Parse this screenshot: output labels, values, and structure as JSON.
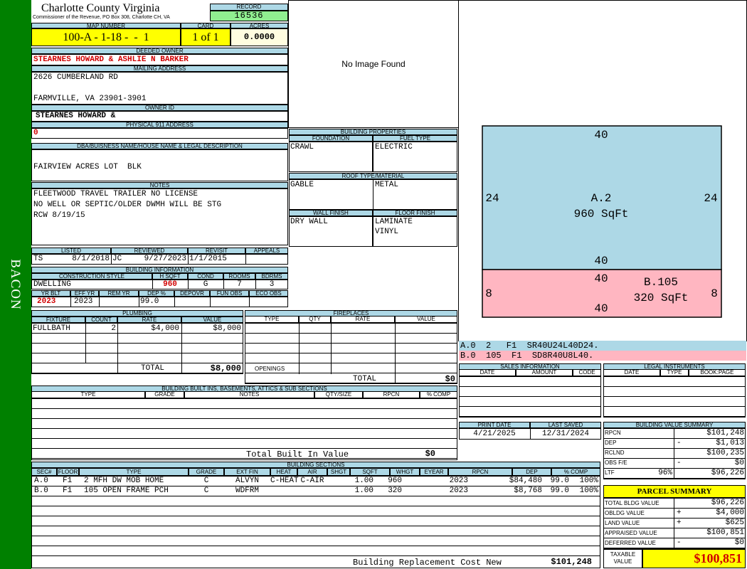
{
  "sidebar": {
    "label": "BACON"
  },
  "header": {
    "county": "Charlotte County Virginia",
    "office": "Commissioner of the Revenue, PO Box 308, Charlotte CH, VA",
    "record_label": "RECORD",
    "record": "16536"
  },
  "parcel": {
    "map_label": "MAP NUMBER",
    "map": "100-A - 1-18 -  -  1",
    "card_label": "CARD",
    "card": "1 of 1",
    "acres_label": "ACRES",
    "acres": "0.0000"
  },
  "owner": {
    "deeded_label": "DEEDED OWNER",
    "deeded": "STEARNES HOWARD & ASHLIE N BARKER",
    "mailing_label": "MAILING ADDRESS",
    "addr1": "2626 CUMBERLAND RD",
    "addr2": "FARMVILLE, VA 23901-3901",
    "owner_id_label": "OWNER ID",
    "owner_id": "STEARNES HOWARD &",
    "physical_label": "PHYSICAL 911 ADDRESS",
    "physical": "0"
  },
  "legal": {
    "label": "DBA/BUISNESS NAME/HOUSE NAME & LEGAL DESCRIPTION",
    "desc": "FAIRVIEW ACRES LOT  BLK"
  },
  "notes": {
    "label": "NOTES",
    "lines": [
      "FLEETWOOD TRAVEL TRAILER NO LICENSE",
      "NO WELL OR SEPTIC/OLDER DWMH WILL BE STG",
      "RCW 8/19/15"
    ]
  },
  "image": {
    "placeholder": "No Image Found"
  },
  "props": {
    "label": "BUILDING PROPERTIES",
    "foundation_label": "FOUNDATION",
    "foundation": "CRAWL",
    "fuel_label": "FUEL TYPE",
    "fuel": "ELECTRIC",
    "roof_label": "ROOF TYPE/MATERIAL",
    "roof_type": "GABLE",
    "roof_mat": "METAL",
    "wall_label": "WALL FINISH",
    "wall": "DRY WALL",
    "floor_label": "FLOOR FINISH",
    "floor1": "LAMINATE",
    "floor2": "VINYL"
  },
  "dates": {
    "listed_label": "LISTED",
    "listed_by": "TS",
    "listed": "8/1/2018",
    "reviewed_label": "REVIEWED",
    "reviewed_by": "JC",
    "reviewed": "9/27/2023",
    "revisit_label": "REVISIT",
    "revisit": "1/1/2015",
    "appeals_label": "APPEALS"
  },
  "building": {
    "label": "BUILDING INFORMATION",
    "style_label": "CONSTRUCTION STYLE",
    "style": "DWELLING",
    "hsqft_label": "H SQFT",
    "hsqft": "960",
    "cond_label": "COND",
    "cond": "G",
    "rooms_label": "ROOMS",
    "rooms": "7",
    "bdrms_label": "BDRMS",
    "bdrms": "3",
    "yrblt_label": "YR BLT",
    "yrblt": "2023",
    "effyr_label": "EFF YR",
    "effyr": "2023",
    "remyr_label": "REM YR",
    "dep_label": "DEP %",
    "dep": "99.0",
    "depovr_label": "DEPOVR",
    "funobs_label": "FUN OBS",
    "ecoobs_label": "ECO OBS"
  },
  "plumbing": {
    "label": "PLUMBING",
    "cols": [
      "FIXTURE",
      "COUNT",
      "RATE",
      "VALUE"
    ],
    "row": {
      "fixture": "FULLBATH",
      "count": "2",
      "rate": "$4,000",
      "value": "$8,000"
    },
    "total_label": "TOTAL",
    "total": "$8,000"
  },
  "fireplaces": {
    "label": "FIREPLACES",
    "cols": [
      "TYPE",
      "QTY",
      "RATE",
      "VALUE"
    ],
    "openings": "OPENINGS",
    "total_label": "TOTAL",
    "total": "$0"
  },
  "builtins": {
    "label": "BUILDING BUILT INS, BASEMENTS, ATTICS & SUB SECTIONS",
    "cols": [
      "TYPE",
      "GRADE",
      "NOTES",
      "QTY/SIZE",
      "RPCN",
      "% COMP"
    ],
    "total_label": "Total Built In Value",
    "total": "$0"
  },
  "sketch": {
    "a": {
      "top": "40",
      "left": "24",
      "right": "24",
      "bottom": "40",
      "name": "A.2",
      "area": "960 SqFt",
      "color": "#add8e6"
    },
    "b": {
      "top": "40",
      "left": "8",
      "right": "8",
      "bottom": "40",
      "name": "B.105",
      "area": "320 SqFt",
      "color": "#ffb6c1"
    },
    "legend": [
      {
        "text": "A.0  2   F1  SR40U24L40D24.",
        "color": "#add8e6"
      },
      {
        "text": "B.0  105  F1  SD8R40U8L40.",
        "color": "#ffb6c1"
      }
    ]
  },
  "sales": {
    "label": "SALES INFORMATION",
    "cols": [
      "DATE",
      "AMOUNT",
      "CODE"
    ]
  },
  "legal_inst": {
    "label": "LEGAL INSTRUMENTS",
    "cols": [
      "DATE",
      "TYPE",
      "BOOK:PAGE"
    ]
  },
  "print": {
    "print_label": "PRINT DATE",
    "print": "4/21/2025",
    "saved_label": "LAST SAVED",
    "saved": "12/31/2024"
  },
  "bvs": {
    "label": "BUILDING VALUE SUMMARY",
    "rows": [
      {
        "k": "RPCN",
        "s": "",
        "v": "$101,248"
      },
      {
        "k": "DEP",
        "s": "-",
        "v": "$1,013"
      },
      {
        "k": "RCLND",
        "s": "",
        "v": "$100,235"
      },
      {
        "k": "OBS F/E",
        "s": "-",
        "v": "$0"
      },
      {
        "k": "LTF",
        "p": "96%",
        "s": "",
        "v": "$96,226"
      }
    ]
  },
  "summary": {
    "label": "PARCEL SUMMARY",
    "rows": [
      {
        "k": "TOTAL BLDG VALUE",
        "s": "",
        "v": "$96,226"
      },
      {
        "k": "OBLDG VALUE",
        "s": "+",
        "v": "$4,000"
      },
      {
        "k": "LAND VALUE",
        "s": "+",
        "v": "$625"
      },
      {
        "k": "APPRAISED VALUE",
        "s": "",
        "v": "$100,851"
      },
      {
        "k": "DEFERRED VALUE",
        "s": "-",
        "v": "$0"
      }
    ],
    "taxable_label1": "TAXABLE",
    "taxable_label2": "VALUE",
    "taxable": "$100,851"
  },
  "sections": {
    "label": "BUILDING SECTIONS",
    "cols": [
      "SEC#",
      "FLOOR",
      "TYPE",
      "GRADE",
      "EXT FIN",
      "HEAT",
      "AIR",
      "SHGT",
      "SQFT",
      "WHGT",
      "EYEAR",
      "RPCN",
      "DEP",
      "% COMP"
    ],
    "rows": [
      [
        "A.0",
        "F1",
        "2 MFH DW MOB HOME",
        "C",
        "ALVYN",
        "C-HEAT",
        "C-AIR",
        "1.00",
        "960",
        "",
        "2023",
        "$84,480",
        "99.0",
        "100%"
      ],
      [
        "B.0",
        "F1",
        "105 OPEN FRAME PCH",
        "C",
        "WDFRM",
        "",
        "",
        "1.00",
        "320",
        "",
        "2023",
        "$8,768",
        "99.0",
        "100%"
      ]
    ],
    "rcn_label": "Building Replacement Cost New",
    "rcn": "$101,248"
  }
}
